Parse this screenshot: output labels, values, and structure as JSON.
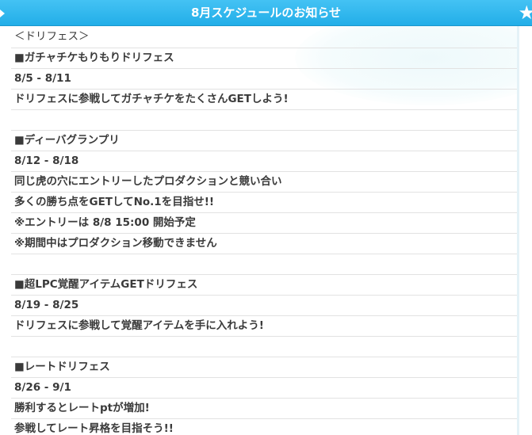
{
  "header": {
    "title": "8月スケジュールのお知らせ",
    "star": "★"
  },
  "rows": [
    "＜ドリフェス＞",
    "■ガチャチケもりもりドリフェス",
    "8/5 - 8/11",
    "ドリフェスに参戦してガチャチケをたくさんGETしよう!",
    "",
    "■ディーバグランプリ",
    "8/12 - 8/18",
    "同じ虎の穴にエントリーしたプロダクションと競い合い",
    "多くの勝ち点をGETしてNo.1を目指せ!!",
    "※エントリーは 8/8 15:00 開始予定",
    "※期間中はプロダクション移動できません",
    "",
    "■超LPC覚醒アイテムGETドリフェス",
    "8/19 - 8/25",
    "ドリフェスに参戦して覚醒アイテムを手に入れよう!",
    "",
    "■レートドリフェス",
    "8/26 - 9/1",
    "勝利するとレートptが増加!",
    "参戦してレート昇格を目指そう!!"
  ]
}
